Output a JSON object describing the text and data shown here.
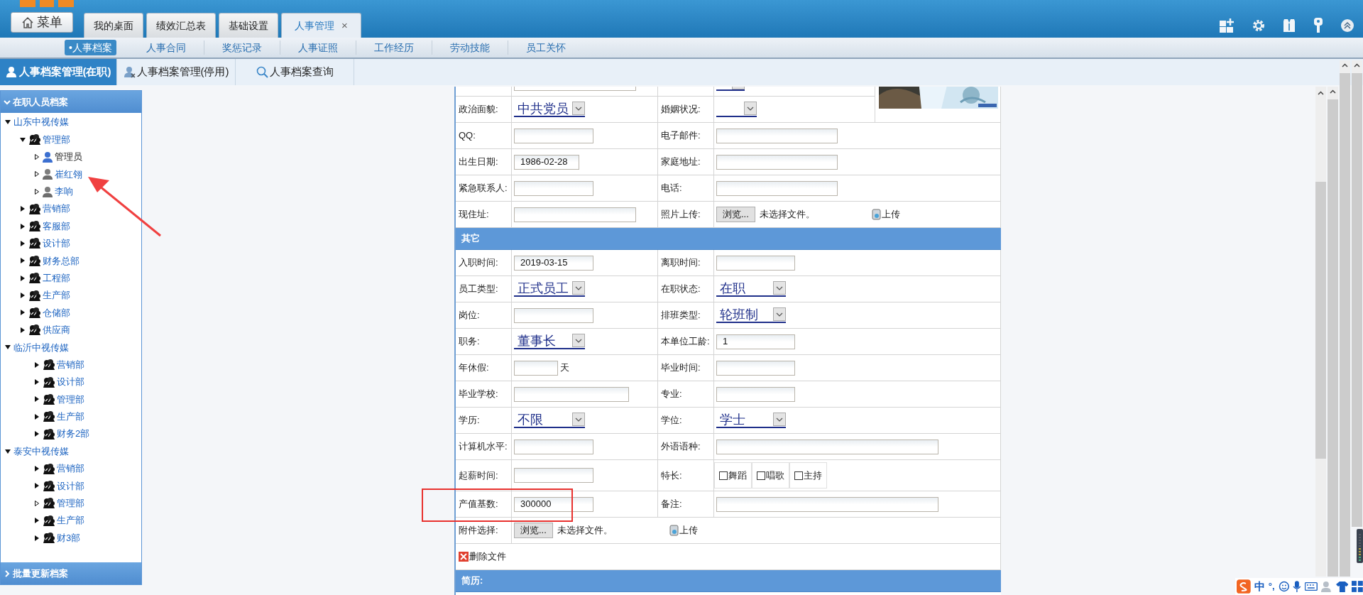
{
  "header": {
    "menu_button": "菜单",
    "tabs": [
      {
        "label": "我的桌面",
        "selected": false,
        "closable": false
      },
      {
        "label": "绩效汇总表",
        "selected": false,
        "closable": false
      },
      {
        "label": "基础设置",
        "selected": false,
        "closable": false
      },
      {
        "label": "人事管理",
        "selected": true,
        "closable": true,
        "close_glyph": "×"
      }
    ]
  },
  "subnav": [
    {
      "label": "•人事档案",
      "selected": true
    },
    {
      "label": "人事合同",
      "selected": false
    },
    {
      "label": "奖惩记录",
      "selected": false
    },
    {
      "label": "人事证照",
      "selected": false
    },
    {
      "label": "工作经历",
      "selected": false
    },
    {
      "label": "劳动技能",
      "selected": false
    },
    {
      "label": "员工关怀",
      "selected": false
    }
  ],
  "view_tabs": [
    {
      "label": "人事档案管理(在职)",
      "kind": "person",
      "selected": true
    },
    {
      "label": "人事档案管理(停用)",
      "kind": "person-off",
      "selected": false
    },
    {
      "label": "人事档案查询",
      "kind": "search",
      "selected": false
    }
  ],
  "sidebar": {
    "title": "在职人员档案",
    "footer": "批量更新档案",
    "tree": [
      {
        "label": "山东中视传媒",
        "kind": "company",
        "expanded": true,
        "children": [
          {
            "label": "管理部",
            "kind": "department",
            "expanded": true,
            "children": [
              {
                "label": "管理员",
                "kind": "admin",
                "expanded": false
              },
              {
                "label": "崔红翎",
                "kind": "person",
                "expanded": false
              },
              {
                "label": "李响",
                "kind": "person",
                "expanded": false
              }
            ]
          },
          {
            "label": "营销部",
            "kind": "department",
            "expanded": false
          },
          {
            "label": "客服部",
            "kind": "department",
            "expanded": false
          },
          {
            "label": "设计部",
            "kind": "department",
            "expanded": false
          },
          {
            "label": "财务总部",
            "kind": "department",
            "expanded": false
          },
          {
            "label": "工程部",
            "kind": "department",
            "expanded": false
          },
          {
            "label": "生产部",
            "kind": "department",
            "expanded": false
          },
          {
            "label": "仓储部",
            "kind": "department",
            "expanded": false
          },
          {
            "label": "供应商",
            "kind": "department",
            "expanded": false
          }
        ]
      },
      {
        "label": "临沂中视传媒",
        "kind": "company",
        "expanded": true,
        "children": [
          {
            "label": "营销部",
            "kind": "department",
            "expanded": false
          },
          {
            "label": "设计部",
            "kind": "department",
            "expanded": false
          },
          {
            "label": "管理部",
            "kind": "department",
            "expanded": false
          },
          {
            "label": "生产部",
            "kind": "department",
            "expanded": false
          },
          {
            "label": "财务2部",
            "kind": "department",
            "expanded": false
          }
        ]
      },
      {
        "label": "泰安中视传媒",
        "kind": "company",
        "expanded": true,
        "children": [
          {
            "label": "营销部",
            "kind": "department",
            "expanded": false
          },
          {
            "label": "设计部",
            "kind": "department",
            "expanded": false
          },
          {
            "label": "管理部",
            "kind": "empty-department",
            "expanded": false
          },
          {
            "label": "生产部",
            "kind": "department",
            "expanded": false
          },
          {
            "label": "财3部",
            "kind": "department",
            "expanded": false
          }
        ]
      }
    ]
  },
  "form": {
    "sections": [
      {
        "rows": [
          {
            "fields": [
              {
                "label": "政治面貌:",
                "kind": "select",
                "value": "中共党员"
              },
              {
                "label": "婚姻状况:",
                "kind": "select"
              }
            ]
          },
          {
            "fields": [
              {
                "label": "QQ:",
                "kind": "input"
              },
              {
                "label": "电子邮件:",
                "kind": "input"
              }
            ]
          },
          {
            "fields": [
              {
                "label": "出生日期:",
                "kind": "input",
                "value": "1986-02-28"
              },
              {
                "label": "家庭地址:",
                "kind": "input"
              }
            ]
          },
          {
            "fields": [
              {
                "label": "紧急联系人:",
                "kind": "input"
              },
              {
                "label": "电话:",
                "kind": "input"
              }
            ]
          },
          {
            "fields": [
              {
                "label": "现住址:",
                "kind": "input"
              },
              {
                "label": "照片上传:",
                "kind": "file",
                "button": "浏览...",
                "status": "未选择文件。",
                "upload": "上传"
              }
            ]
          }
        ]
      },
      {
        "title": "其它",
        "rows": [
          {
            "fields": [
              {
                "label": "入职时间:",
                "kind": "input",
                "value": "2019-03-15"
              },
              {
                "label": "离职时间:",
                "kind": "input"
              }
            ]
          },
          {
            "fields": [
              {
                "label": "员工类型:",
                "kind": "select",
                "value": "正式员工"
              },
              {
                "label": "在职状态:",
                "kind": "select",
                "value": "在职"
              }
            ]
          },
          {
            "fields": [
              {
                "label": "岗位:",
                "kind": "input"
              },
              {
                "label": "排班类型:",
                "kind": "select",
                "value": "轮班制"
              }
            ]
          },
          {
            "fields": [
              {
                "label": "职务:",
                "kind": "select",
                "value": "董事长"
              },
              {
                "label": "本单位工龄:",
                "kind": "input",
                "value": "1"
              }
            ]
          },
          {
            "fields": [
              {
                "label": "年休假:",
                "kind": "input",
                "suffix": "天"
              },
              {
                "label": "毕业时间:",
                "kind": "input"
              }
            ]
          },
          {
            "fields": [
              {
                "label": "毕业学校:",
                "kind": "input"
              },
              {
                "label": "专业:",
                "kind": "input"
              }
            ]
          },
          {
            "fields": [
              {
                "label": "学历:",
                "kind": "select",
                "value": "不限"
              },
              {
                "label": "学位:",
                "kind": "select",
                "value": "学士"
              }
            ]
          },
          {
            "fields": [
              {
                "label": "计算机水平:",
                "kind": "input"
              },
              {
                "label": "外语语种:",
                "kind": "input"
              }
            ]
          },
          {
            "fields": [
              {
                "label": "起薪时间:",
                "kind": "input"
              },
              {
                "label": "特长:",
                "kind": "checkboxes",
                "options": [
                  {
                    "label": "舞蹈",
                    "checked": false
                  },
                  {
                    "label": "唱歌",
                    "checked": false
                  },
                  {
                    "label": "主持",
                    "checked": false
                  }
                ]
              }
            ]
          },
          {
            "fields": [
              {
                "label": "产值基数:",
                "kind": "input",
                "value": "300000"
              },
              {
                "label": "备注:",
                "kind": "input"
              }
            ]
          },
          {
            "fields": [
              {
                "label": "附件选择:",
                "kind": "file",
                "button": "浏览...",
                "status": "未选择文件。",
                "upload": "上传"
              }
            ]
          },
          {
            "fields": [
              {
                "kind": "delete",
                "label": "删除文件"
              }
            ]
          }
        ]
      },
      {
        "title": "简历:"
      }
    ]
  },
  "ime": {
    "mode": "中",
    "punctuation": "°,"
  }
}
